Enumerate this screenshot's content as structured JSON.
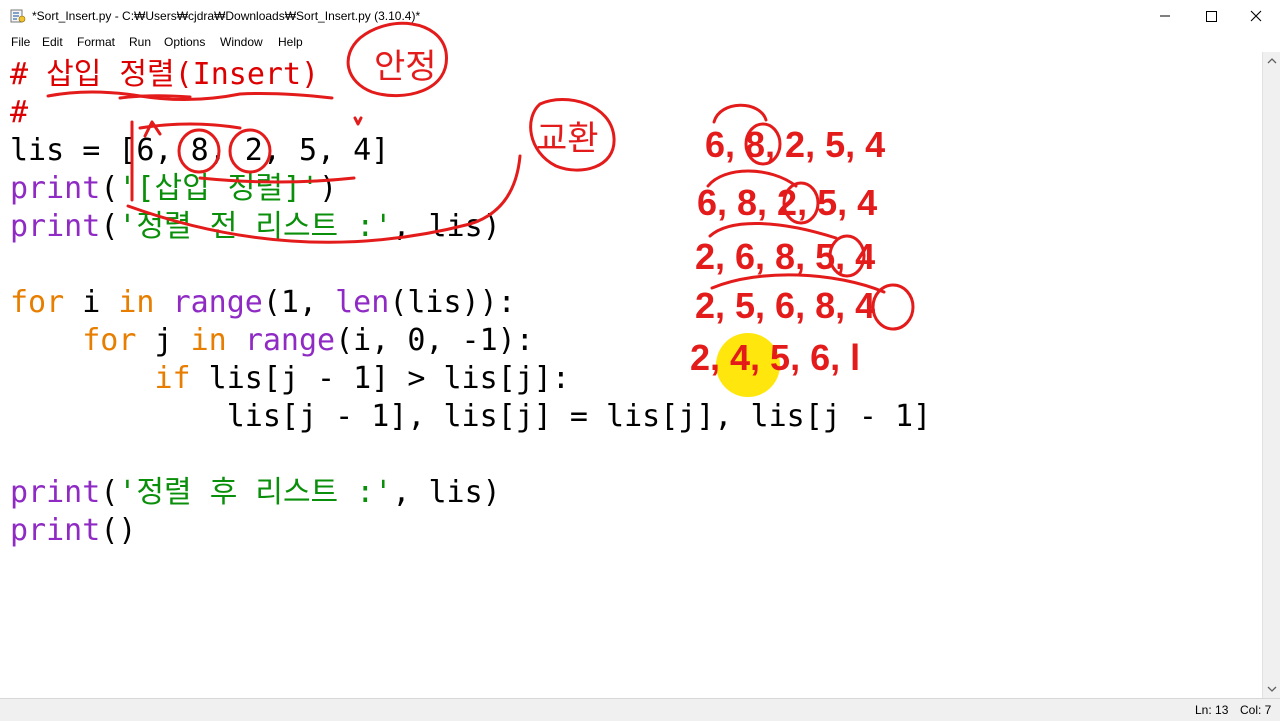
{
  "window": {
    "title": "*Sort_Insert.py - C:₩Users₩cjdra₩Downloads₩Sort_Insert.py (3.10.4)*",
    "controls": {
      "minimize": "—",
      "maximize": "☐",
      "close": "✕"
    }
  },
  "menu": [
    "File",
    "Edit",
    "Format",
    "Run",
    "Options",
    "Window",
    "Help"
  ],
  "code": {
    "l1": "# 삽입 정렬(Insert)",
    "l2": "#",
    "l3_a": "lis = [6, 8, 2, 5, 4]",
    "l4_fn": "print",
    "l4_open": "(",
    "l4_str": "'[삽입 정렬]'",
    "l4_close": ")",
    "l5_fn": "print",
    "l5_open": "(",
    "l5_str": "'정렬 전 리스트 :'",
    "l5_rest": ", lis)",
    "l7_kw1": "for",
    "l7_a": " i ",
    "l7_kw2": "in",
    "l7_sp": " ",
    "l7_fn1": "range",
    "l7_b": "(1, ",
    "l7_fn2": "len",
    "l7_c": "(lis)):",
    "l8_indent": "    ",
    "l8_kw1": "for",
    "l8_a": " j ",
    "l8_kw2": "in",
    "l8_sp": " ",
    "l8_fn": "range",
    "l8_b": "(i, 0, -1):",
    "l9_indent": "        ",
    "l9_kw": "if",
    "l9_a": " lis[j - 1] > lis[j]:",
    "l10": "            lis[j - 1], lis[j] = lis[j], lis[j - 1]",
    "l12_fn": "print",
    "l12_open": "(",
    "l12_str": "'정렬 후 리스트 :'",
    "l12_rest": ", lis)",
    "l13_fn": "print",
    "l13_rest": "()"
  },
  "annotations": {
    "stable_note": "안정",
    "exchange_note": "교환",
    "steps": [
      "6, 8, 2, 5, 4",
      "6, 8, 2, 5, 4",
      "2, 6, 8, 5, 4",
      "2, 5, 6, 8, 4",
      "2, 4, 5, 6, l"
    ]
  },
  "status": {
    "line": "Ln: 13",
    "col": "Col: 7"
  },
  "colors": {
    "keyword": "#e77e00",
    "builtin": "#8f2bc4",
    "string": "#0a8f0a",
    "comment": "#dd0000",
    "annotation": "#e41b1b",
    "highlight": "#ffe600"
  }
}
